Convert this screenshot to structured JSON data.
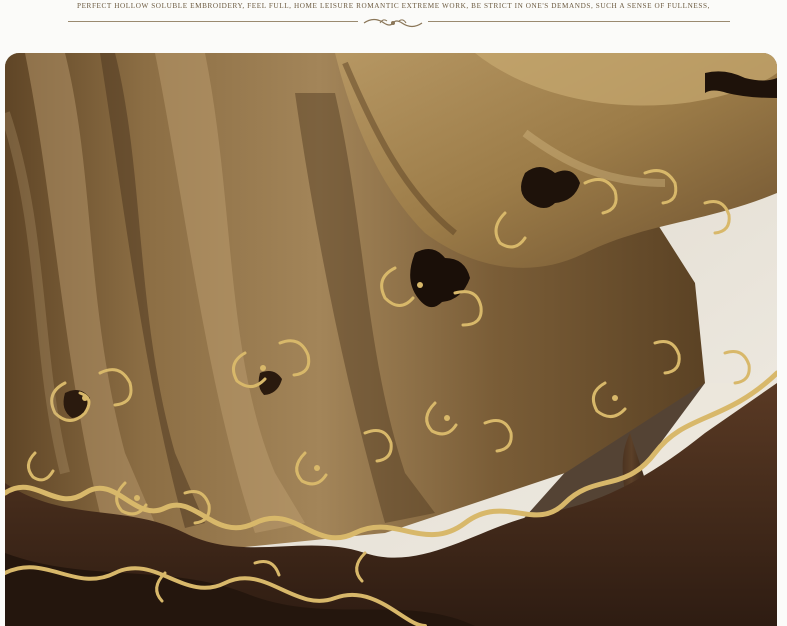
{
  "banner": {
    "caption": "PERFECT HOLLOW SOLUBLE EMBROIDERY, FEEL FULL, HOME LEISURE ROMANTIC EXTREME WORK, BE STRICT IN ONE'S DEMANDS, SUCH A SENSE OF FULLNESS,"
  },
  "photo": {
    "subject": "Brown chenille curtain with gold hollow-cut embroidery over a dark scalloped lining, ornate furniture leg in background",
    "colors": {
      "fabric_light": "#a88a5c",
      "fabric_mid": "#7a5c34",
      "fabric_dark": "#3e2a18",
      "gold": "#d8b86a",
      "lining": "#4a3020",
      "background": "#e9e4da"
    }
  }
}
